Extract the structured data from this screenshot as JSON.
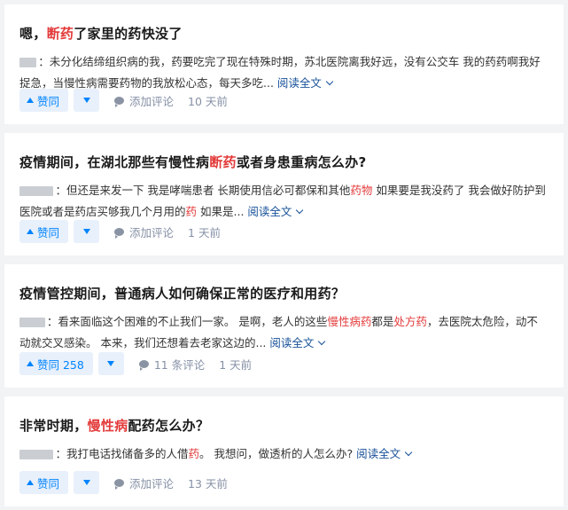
{
  "cards": [
    {
      "title": [
        "嗯，",
        "断药",
        "了家里的药快没了"
      ],
      "author_mask": "▇▇",
      "excerpt": [
        "：未分化结缔组织病的我，药要吃完了现在特殊时期，苏北医院离我好远，没有公交车 我的药药啊我好捉急，当慢性病需要药物的我放松心态，每天多吃..."
      ],
      "read_more": "阅读全文",
      "vote_label": "赞同",
      "comment_label": "添加评论",
      "time": "10 天前"
    },
    {
      "title": [
        "疫情期间，在湖北那些有慢性病",
        "断药",
        "或者身患重病怎么办?"
      ],
      "author_mask": "▇▇▇▇",
      "excerpt": [
        "：但还是来发一下 我是哮喘患者 长期使用信必可都保和其他",
        "药物",
        " 如果要是我没药了 我会做好防护到医院或者是药店买够我几个月用的",
        "药",
        " 如果是..."
      ],
      "read_more": "阅读全文",
      "vote_label": "赞同",
      "comment_label": "添加评论",
      "time": "1 天前"
    },
    {
      "title": [
        "疫情管控期间，普通病人如何确保正常的医疗和用药？"
      ],
      "author_mask": "▇▇▇",
      "excerpt": [
        "：看来面临这个困难的不止我们一家。 是啊，老人的这些",
        "慢性病药",
        "都是",
        "处方药",
        "，去医院太危险，动不动就交叉感染。 本来，我们还想着去老家这边的..."
      ],
      "read_more": "阅读全文",
      "vote_label": "赞同 258",
      "comment_label": "11 条评论",
      "time": "1 天前"
    },
    {
      "title": [
        "非常时期，",
        "慢性病",
        "配药怎么办？"
      ],
      "author_mask": "▇▇▇▇",
      "excerpt": [
        "：我打电话找储备多的人借",
        "药",
        "。 我想问，做透析的人怎么办?"
      ],
      "read_more": "阅读全文",
      "vote_label": "赞同",
      "comment_label": "添加评论",
      "time": "13 天前"
    }
  ],
  "colors": {
    "highlight": "#e33b3b",
    "link": "#175199",
    "vote": "#0084ff",
    "vote_bg": "#e8f0fb",
    "meta": "#8590a6"
  },
  "icons": {
    "vote_up": "triangle-up-icon",
    "vote_down": "triangle-down-icon",
    "comment": "comment-bubble-icon",
    "read_more": "chevron-down-icon"
  }
}
